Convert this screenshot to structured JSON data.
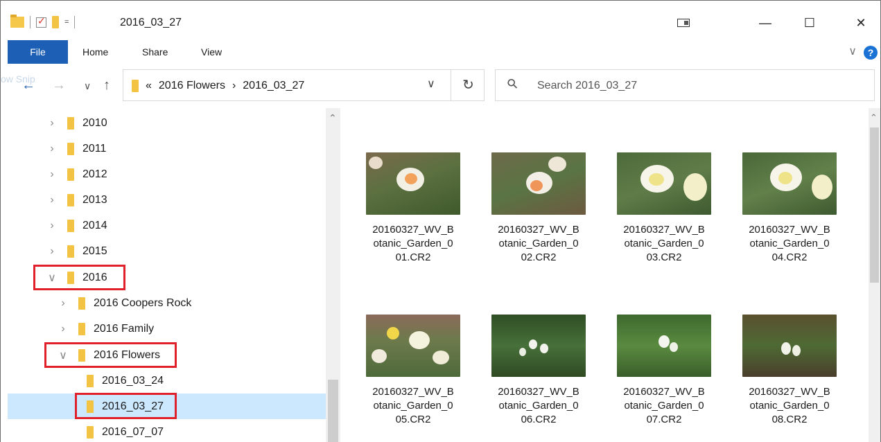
{
  "titlebar": {
    "title": "2016_03_27",
    "qat_dropdown": "=",
    "minimize": "—",
    "maximize": "☐",
    "close": "✕"
  },
  "ribbon": {
    "tabs": [
      "File",
      "Home",
      "Share",
      "View"
    ],
    "help": "?",
    "chevron": "∨"
  },
  "nav": {
    "back": "←",
    "forward": "→",
    "recent": "∨",
    "up": "↑",
    "ghost_text": "ow Snip",
    "breadcrumb_overflow": "«",
    "breadcrumb": [
      "2016 Flowers",
      "2016_03_27"
    ],
    "breadcrumb_sep": "›",
    "address_dropdown": "∨",
    "refresh": "↻",
    "search_placeholder": "Search 2016_03_27"
  },
  "tree": [
    {
      "label": "2010",
      "chevron": "›",
      "expanded": false
    },
    {
      "label": "2011",
      "chevron": "›",
      "expanded": false
    },
    {
      "label": "2012",
      "chevron": "›",
      "expanded": false
    },
    {
      "label": "2013",
      "chevron": "›",
      "expanded": false
    },
    {
      "label": "2014",
      "chevron": "›",
      "expanded": false
    },
    {
      "label": "2015",
      "chevron": "›",
      "expanded": false
    },
    {
      "label": "2016",
      "chevron": "∨",
      "expanded": true
    },
    {
      "label": "2016 Coopers Rock",
      "chevron": "›",
      "expanded": false
    },
    {
      "label": "2016 Family",
      "chevron": "›",
      "expanded": false
    },
    {
      "label": "2016 Flowers",
      "chevron": "∨",
      "expanded": true
    },
    {
      "label": "2016_03_24",
      "chevron": "",
      "expanded": false
    },
    {
      "label": "2016_03_27",
      "chevron": "",
      "expanded": false,
      "selected": true
    },
    {
      "label": "2016_07_07",
      "chevron": "",
      "expanded": false
    }
  ],
  "files": [
    {
      "name": "20160327_WV_B\notanic_Garden_0\n01.CR2",
      "tint": "orange"
    },
    {
      "name": "20160327_WV_B\notanic_Garden_0\n02.CR2",
      "tint": "orange"
    },
    {
      "name": "20160327_WV_B\notanic_Garden_0\n03.CR2",
      "tint": "yellow"
    },
    {
      "name": "20160327_WV_B\notanic_Garden_0\n04.CR2",
      "tint": "yellow"
    },
    {
      "name": "20160327_WV_B\notanic_Garden_0\n05.CR2",
      "tint": "daffodil"
    },
    {
      "name": "20160327_WV_B\notanic_Garden_0\n06.CR2",
      "tint": "snowdrop"
    },
    {
      "name": "20160327_WV_B\notanic_Garden_0\n07.CR2",
      "tint": "snowdrop"
    },
    {
      "name": "20160327_WV_B\notanic_Garden_0\n08.CR2",
      "tint": "snowdrop"
    }
  ],
  "colors": {
    "file_tab": "#1d5fb5",
    "selection": "#cce8ff",
    "highlight": "#e0202a",
    "folder": "#f5c84c"
  }
}
